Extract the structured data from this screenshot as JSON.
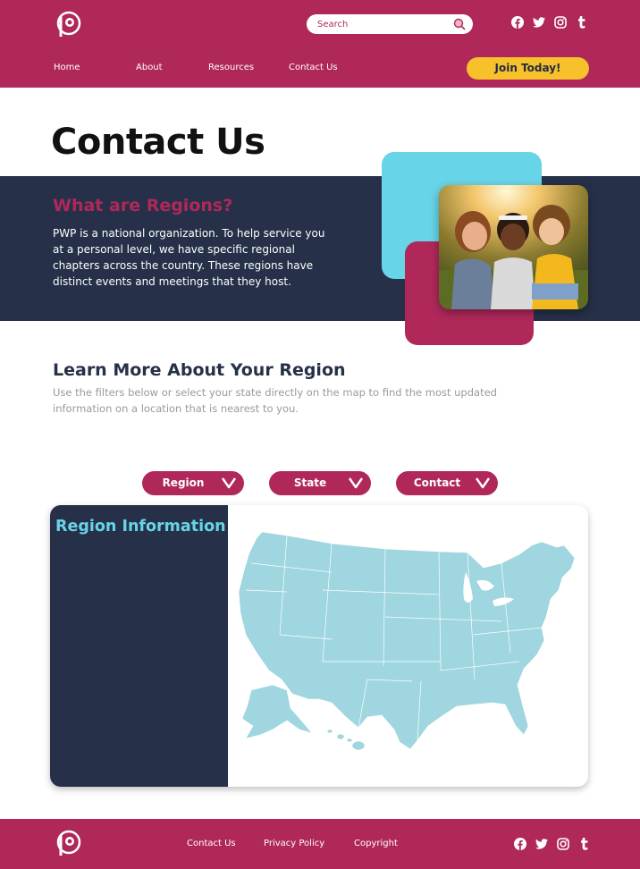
{
  "header": {
    "search_placeholder": "Search",
    "nav": [
      "Home",
      "About",
      "Resources",
      "Contact Us"
    ],
    "join_label": "Join Today!",
    "social_icons": [
      "facebook-icon",
      "twitter-icon",
      "instagram-icon",
      "tumblr-icon"
    ]
  },
  "page": {
    "title": "Contact Us"
  },
  "regions_intro": {
    "heading": "What are Regions?",
    "body": "PWP is a national organization. To help service you at a personal level, we have specific regional chapters across the country.  These regions have distinct events and meetings that they host."
  },
  "learn": {
    "heading": "Learn More About Your Region",
    "body": "Use the filters below or select your state directly on the map to find the most updated information on a location that is nearest to you."
  },
  "filters": [
    "Region",
    "State",
    "Contact"
  ],
  "region_panel": {
    "title": "Region Information"
  },
  "footer": {
    "links": [
      "Contact Us",
      "Privacy Policy",
      "Copyright"
    ]
  },
  "colors": {
    "brand": "#b0285a",
    "navy": "#263048",
    "cyan": "#67d4e8",
    "yellow": "#f6c12a",
    "map": "#9fd6df"
  }
}
